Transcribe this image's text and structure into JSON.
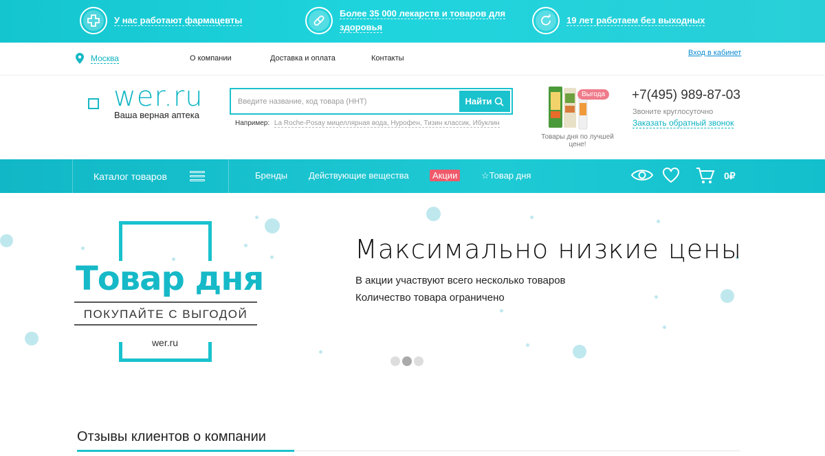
{
  "benefits": [
    {
      "text": "У нас работают фармацевты",
      "icon": "cross-icon"
    },
    {
      "text": "Более 35 000 лекарств и товаров для здоровья",
      "icon": "pill-icon"
    },
    {
      "text": "19 лет работаем без выходных",
      "icon": "refresh-icon"
    }
  ],
  "header": {
    "city": "Москва",
    "links": [
      "О компании",
      "Доставка и оплата",
      "Контакты"
    ],
    "login": "Вход в кабинет"
  },
  "logo": {
    "text": "wer.ru",
    "tagline": "Ваша верная аптека"
  },
  "search": {
    "placeholder": "Введите название, код товара (ННТ)",
    "button": "Найти",
    "example_label": "Например:",
    "example_text": "La Roche-Posay мицеллярная вода, Нурофен, Тизин классик, Ибуклин"
  },
  "deal": {
    "badge": "Выгода",
    "caption": "Товары дня по лучшей цене!"
  },
  "contact": {
    "phone": "+7(495) 989-87-03",
    "hours": "Звоните круглосуточно",
    "callback": "Заказать обратный звонок"
  },
  "menu": {
    "catalog": "Каталог товаров",
    "items": [
      "Бренды",
      "Действующие вещества",
      "Акции",
      "☆Товар дня"
    ],
    "cart_total": "0₽"
  },
  "banner": {
    "promo_title": "Товар дня",
    "promo_sub": "ПОКУПАЙТЕ С ВЫГОДОЙ",
    "promo_site": "wer.ru",
    "title": "Максимально низкие цены",
    "line1": "В акции участвуют всего несколько товаров",
    "line2": "Количество товара ограничено"
  },
  "reviews": {
    "title": "Отзывы клиентов о компании"
  },
  "colors": {
    "accent": "#19c2cd",
    "sale": "#ef5a6a",
    "link": "#0a8cd1"
  }
}
